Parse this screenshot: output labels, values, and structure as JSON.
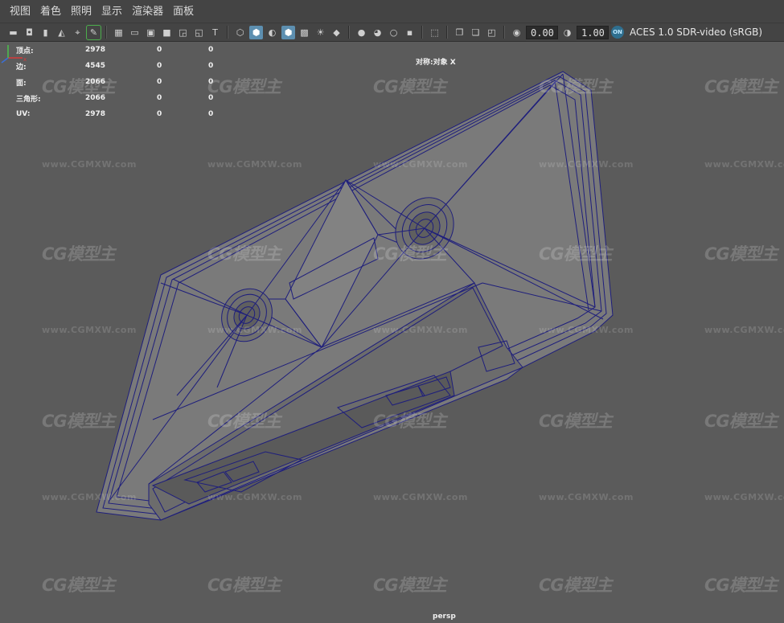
{
  "menu": [
    "视图",
    "着色",
    "照明",
    "显示",
    "渲染器",
    "面板"
  ],
  "toolbar": {
    "exposure_value": "0.00",
    "gamma_value": "1.00",
    "color_space": "ACES 1.0 SDR-video (sRGB)",
    "on_badge": "ON"
  },
  "hud": {
    "rows": [
      {
        "label": "顶点:",
        "v1": "2978",
        "v2": "0",
        "v3": "0"
      },
      {
        "label": "边:",
        "v1": "4545",
        "v2": "0",
        "v3": "0"
      },
      {
        "label": "面:",
        "v1": "2066",
        "v2": "0",
        "v3": "0"
      },
      {
        "label": "三角形:",
        "v1": "2066",
        "v2": "0",
        "v3": "0"
      },
      {
        "label": "UV:",
        "v1": "2978",
        "v2": "0",
        "v3": "0"
      }
    ],
    "symmetry": "对称:对象 X",
    "camera": "persp"
  },
  "watermark": {
    "logo": "CG模型主",
    "url": "www.CGMXW.com"
  },
  "colors": {
    "menubar": "#444444",
    "viewport_bg": "#5b5b5b",
    "wireframe": "#1a1a7a",
    "mesh_fill": "#7a7a7a",
    "active_icon": "#5d8fb0"
  }
}
